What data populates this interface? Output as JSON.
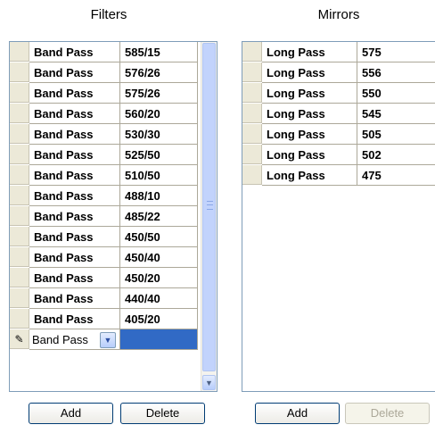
{
  "filters": {
    "title": "Filters",
    "rows": [
      [
        "Band Pass",
        "585/15"
      ],
      [
        "Band Pass",
        "576/26"
      ],
      [
        "Band Pass",
        "575/26"
      ],
      [
        "Band Pass",
        "560/20"
      ],
      [
        "Band Pass",
        "530/30"
      ],
      [
        "Band Pass",
        "525/50"
      ],
      [
        "Band Pass",
        "510/50"
      ],
      [
        "Band Pass",
        "488/10"
      ],
      [
        "Band Pass",
        "485/22"
      ],
      [
        "Band Pass",
        "450/50"
      ],
      [
        "Band Pass",
        "450/40"
      ],
      [
        "Band Pass",
        "450/20"
      ],
      [
        "Band Pass",
        "440/40"
      ],
      [
        "Band Pass",
        "405/20"
      ]
    ],
    "edit_row": {
      "type_value": "Band Pass",
      "value": ""
    },
    "add_label": "Add",
    "delete_label": "Delete"
  },
  "mirrors": {
    "title": "Mirrors",
    "rows": [
      [
        "Long Pass",
        "575"
      ],
      [
        "Long Pass",
        "556"
      ],
      [
        "Long Pass",
        "550"
      ],
      [
        "Long Pass",
        "545"
      ],
      [
        "Long Pass",
        "505"
      ],
      [
        "Long Pass",
        "502"
      ],
      [
        "Long Pass",
        "475"
      ]
    ],
    "add_label": "Add",
    "delete_label": "Delete"
  },
  "icons": {
    "edit_row": "pencil-icon",
    "dropdown": "chevron-down-icon",
    "scroll_down": "scroll-down-arrow-icon"
  },
  "colors": {
    "header_cell": "#ece9d8",
    "selection": "#316ac5",
    "grid_border": "#7f9db9"
  }
}
